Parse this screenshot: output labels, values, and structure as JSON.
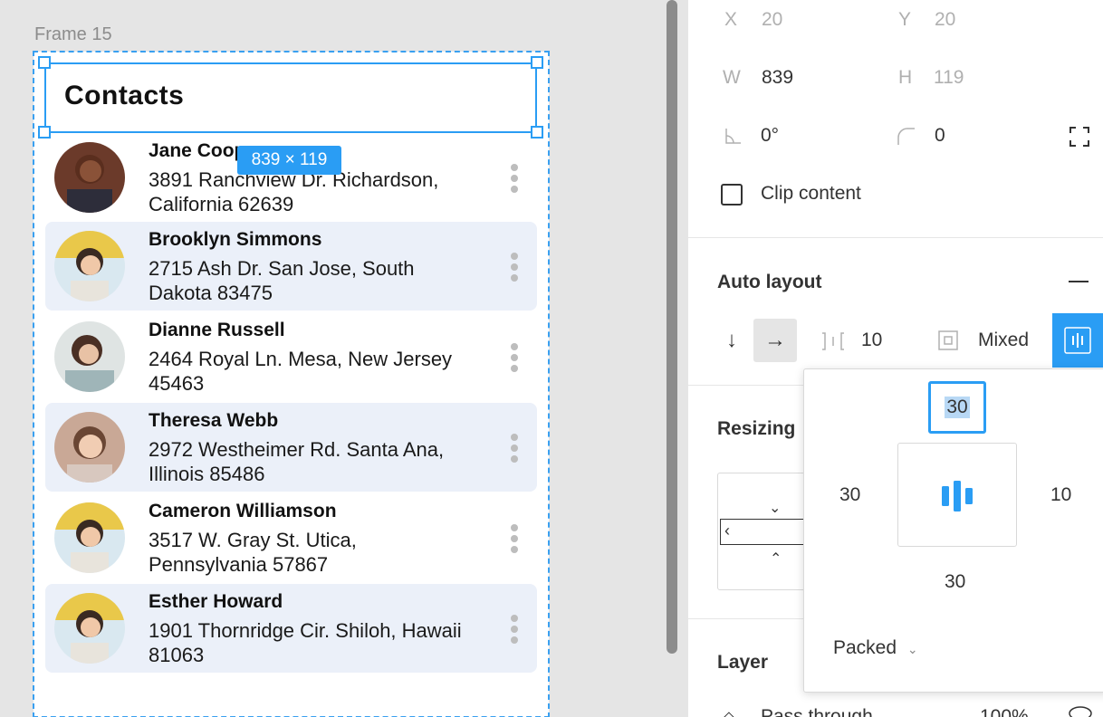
{
  "canvas": {
    "frame_label": "Frame 15",
    "header_title": "Contacts",
    "size_badge": "839 × 119",
    "contacts": [
      {
        "name": "Jane Cooper",
        "address": "3891 Ranchview Dr. Richardson, California 62639",
        "highlighted": false
      },
      {
        "name": "Brooklyn Simmons",
        "address": "2715 Ash Dr. San Jose, South Dakota 83475",
        "highlighted": true
      },
      {
        "name": "Dianne Russell",
        "address": "2464 Royal Ln. Mesa, New Jersey 45463",
        "highlighted": false
      },
      {
        "name": "Theresa Webb",
        "address": "2972 Westheimer Rd. Santa Ana, Illinois 85486",
        "highlighted": true
      },
      {
        "name": "Cameron Williamson",
        "address": "3517 W. Gray St. Utica, Pennsylvania 57867",
        "highlighted": false
      },
      {
        "name": "Esther Howard",
        "address": "1901 Thornridge Cir. Shiloh, Hawaii 81063",
        "highlighted": true
      }
    ]
  },
  "panel": {
    "x_label": "X",
    "x_value": "20",
    "y_label": "Y",
    "y_value": "20",
    "w_label": "W",
    "w_value": "839",
    "h_label": "H",
    "h_value": "119",
    "rotation_value": "0°",
    "radius_value": "0",
    "clip_content_label": "Clip content",
    "auto_layout_title": "Auto layout",
    "spacing_value": "10",
    "padding_mode": "Mixed",
    "resizing_title": "Resizing",
    "layer_title": "Layer",
    "layer_blend": "Pass through",
    "layer_opacity": "100%"
  },
  "popover": {
    "padding_top": "30",
    "padding_left": "30",
    "padding_right": "10",
    "padding_bottom": "30",
    "distribution": "Packed"
  },
  "colors": {
    "accent": "#2a9df4",
    "row_highlight": "#ebf0f9"
  }
}
